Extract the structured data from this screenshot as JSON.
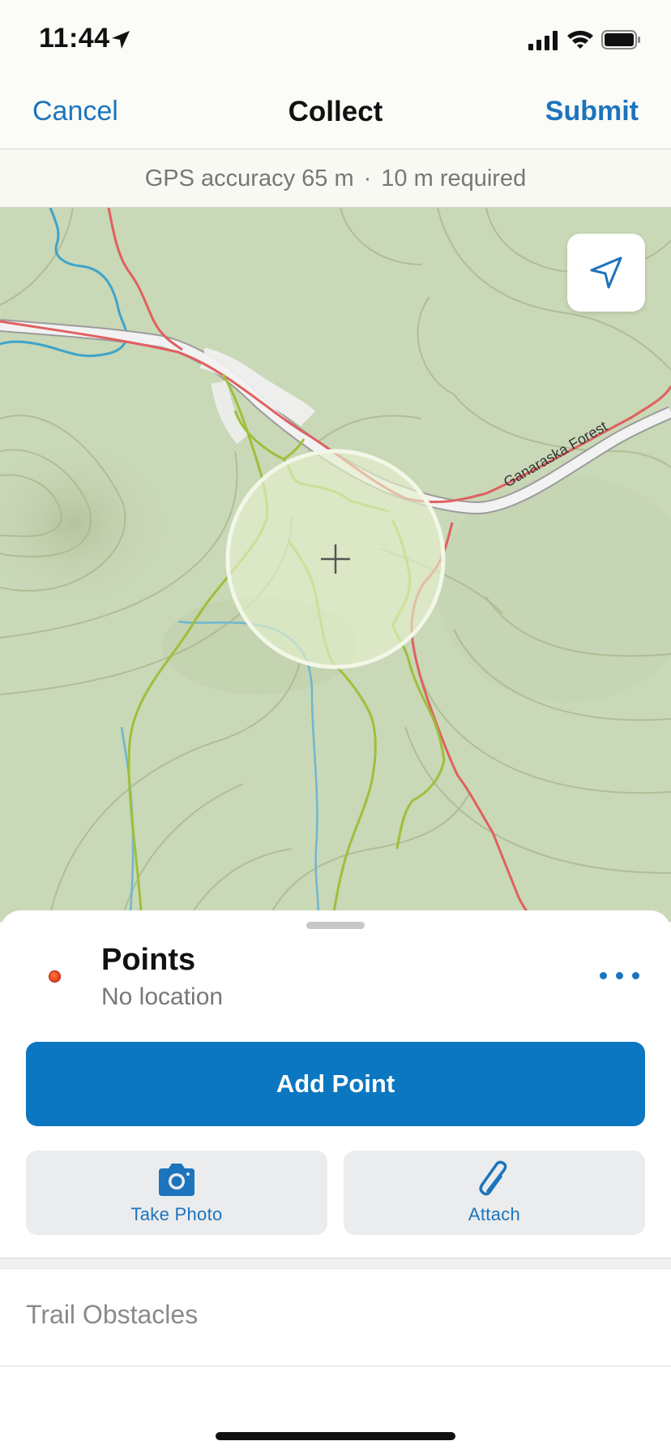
{
  "status_bar": {
    "time": "11:44",
    "icons": [
      "location-arrow-icon",
      "signal-icon",
      "wifi-icon",
      "battery-icon"
    ]
  },
  "nav": {
    "cancel_label": "Cancel",
    "title": "Collect",
    "submit_label": "Submit"
  },
  "gps": {
    "accuracy_text": "GPS accuracy 65 m",
    "separator": "·",
    "required_text": "10 m required"
  },
  "map": {
    "road_label": "Ganaraska Forest",
    "locate_icon": "navigation-arrow-icon",
    "crosshair_icon": "crosshair-icon"
  },
  "sheet": {
    "layer_title": "Points",
    "layer_subtitle": "No location",
    "add_button_label": "Add Point",
    "take_photo_label": "Take Photo",
    "attach_label": "Attach",
    "field_label": "Trail Obstacles"
  },
  "colors": {
    "accent": "#1c74bd",
    "primary_button": "#0c77c1",
    "map_background": "#c9d8b7",
    "trail_green": "#9fbf3a",
    "road_red": "#e06060",
    "water_blue": "#3ea4c9"
  }
}
